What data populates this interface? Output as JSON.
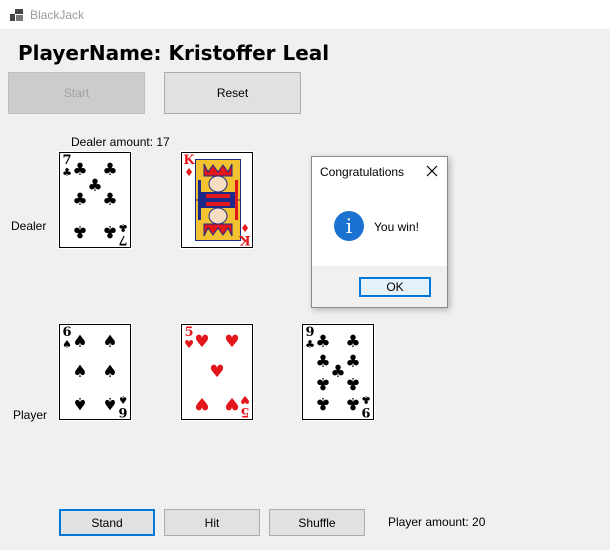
{
  "window": {
    "title": "BlackJack",
    "icon": "app-window-icon"
  },
  "player_name": "PlayerName: Kristoffer Leal",
  "buttons": {
    "start": "Start",
    "reset": "Reset",
    "stand": "Stand",
    "hit": "Hit",
    "shuffle": "Shuffle"
  },
  "dealer": {
    "label": "Dealer",
    "amount_text": "Dealer amount: 17",
    "cards": [
      {
        "rank": "7",
        "suit": "♣",
        "color": "black"
      },
      {
        "rank": "K",
        "suit": "♦",
        "color": "red"
      }
    ]
  },
  "player": {
    "label": "Player",
    "amount_text": "Player amount: 20",
    "cards": [
      {
        "rank": "6",
        "suit": "♠",
        "color": "black"
      },
      {
        "rank": "5",
        "suit": "♥",
        "color": "red"
      },
      {
        "rank": "9",
        "suit": "♣",
        "color": "black"
      }
    ]
  },
  "dialog": {
    "title": "Congratulations",
    "message": "You win!",
    "ok_label": "OK",
    "icon": "info-icon",
    "close_icon": "close-icon"
  },
  "colors": {
    "accent": "#0078d7",
    "card_red": "#e3171b",
    "info_blue": "#1b72d0"
  }
}
